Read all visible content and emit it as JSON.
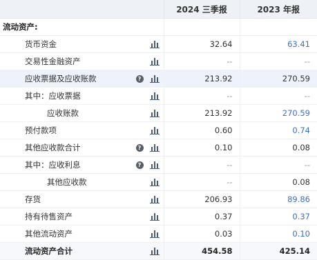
{
  "header": {
    "col1": "",
    "col2": "2024 三季报",
    "col3": "2023 年报"
  },
  "section_title": "流动资产:",
  "rows": [
    {
      "label": "货币资金",
      "q3": "32.64",
      "y23": "63.41",
      "y23_blue": true,
      "q3_blue": false,
      "info": false,
      "indent": 1
    },
    {
      "label": "交易性金融资产",
      "q3": "--",
      "y23": "--",
      "info": false,
      "indent": 1
    },
    {
      "label": "应收票据及应收账款",
      "q3": "213.92",
      "y23": "270.59",
      "info": true,
      "indent": 1,
      "highlight": true
    },
    {
      "label": "其中：应收票据",
      "q3": "--",
      "y23": "--",
      "info": false,
      "indent": 1
    },
    {
      "label": "应收账款",
      "q3": "213.92",
      "y23": "270.59",
      "y23_blue": true,
      "info": false,
      "indent": 2
    },
    {
      "label": "预付款项",
      "q3": "0.60",
      "y23": "0.74",
      "y23_blue": true,
      "info": false,
      "indent": 1
    },
    {
      "label": "其他应收款合计",
      "q3": "0.10",
      "y23": "0.08",
      "info": true,
      "indent": 1
    },
    {
      "label": "其中：应收利息",
      "q3": "--",
      "y23": "--",
      "info": true,
      "indent": 1
    },
    {
      "label": "其他应收款",
      "q3": "--",
      "y23": "0.08",
      "info": false,
      "indent": 2
    },
    {
      "label": "存货",
      "q3": "206.93",
      "y23": "89.86",
      "y23_blue": true,
      "info": false,
      "indent": 1
    },
    {
      "label": "持有待售资产",
      "q3": "0.37",
      "y23": "0.37",
      "y23_blue": true,
      "info": false,
      "indent": 1
    },
    {
      "label": "其他流动资产",
      "q3": "0.03",
      "y23": "0.10",
      "y23_blue": true,
      "info": false,
      "indent": 1
    }
  ],
  "total": {
    "label": "流动资产合计",
    "q3": "454.58",
    "y23": "425.14"
  },
  "icons": {
    "chart": "bar-chart-icon",
    "info": "question-circle-icon"
  },
  "colors": {
    "header_bg": "#eef2f7",
    "highlight_bg": "#eef3fb",
    "link_blue": "#3c6fd1",
    "dash_gray": "#999999"
  }
}
